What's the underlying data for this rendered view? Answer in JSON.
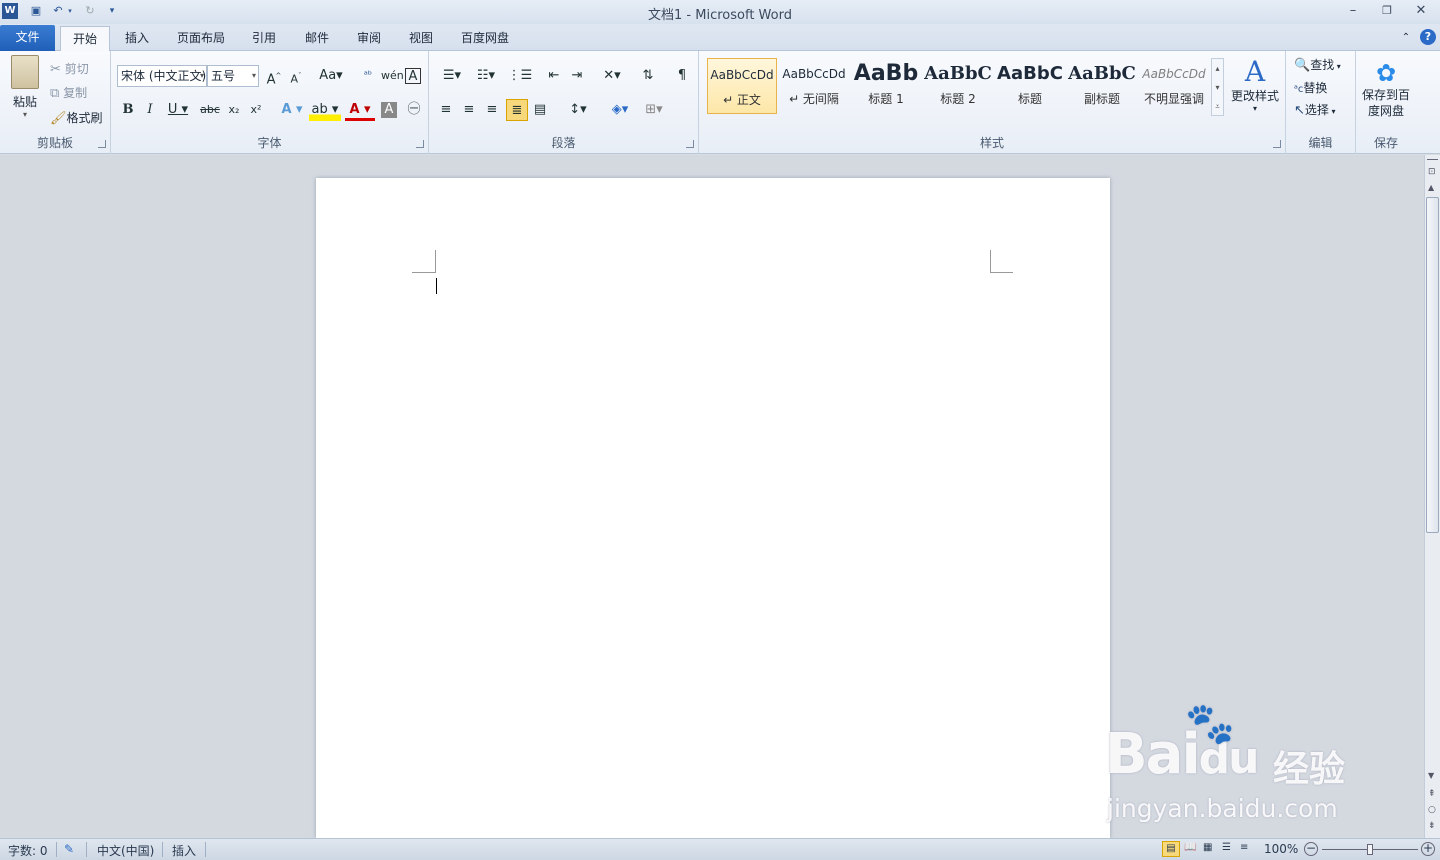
{
  "window": {
    "title": "文档1 - Microsoft Word"
  },
  "tabs": [
    {
      "label": "文件"
    },
    {
      "label": "开始"
    },
    {
      "label": "插入"
    },
    {
      "label": "页面布局"
    },
    {
      "label": "引用"
    },
    {
      "label": "邮件"
    },
    {
      "label": "审阅"
    },
    {
      "label": "视图"
    },
    {
      "label": "百度网盘"
    }
  ],
  "clipboard": {
    "group": "剪贴板",
    "paste": "粘贴",
    "cut": "剪切",
    "copy": "复制",
    "format_painter": "格式刷"
  },
  "font": {
    "group": "字体",
    "font_name": "宋体 (中文正文)",
    "font_size": "五号"
  },
  "paragraph": {
    "group": "段落"
  },
  "styles": {
    "group": "样式",
    "items": [
      {
        "sample": "AaBbCcDd",
        "name": "↵ 正文"
      },
      {
        "sample": "AaBbCcDd",
        "name": "↵ 无间隔"
      },
      {
        "sample": "AaBb",
        "name": "标题 1"
      },
      {
        "sample": "AaBbC",
        "name": "标题 2"
      },
      {
        "sample": "AaBbC",
        "name": "标题"
      },
      {
        "sample": "AaBbC",
        "name": "副标题"
      },
      {
        "sample": "AaBbCcDd",
        "name": "不明显强调"
      }
    ],
    "change_styles": "更改样式"
  },
  "editing": {
    "group": "编辑",
    "find": "查找",
    "replace": "替换",
    "select": "选择"
  },
  "save_group": {
    "group": "保存",
    "button": "保存到百度网盘"
  },
  "status": {
    "words": "字数: 0",
    "language": "中文(中国)",
    "mode": "插入",
    "zoom": "100%"
  },
  "watermark": {
    "brand": "Bai",
    "brand2": "du",
    "jingyan": "经验",
    "url": "jingyan.baidu.com"
  },
  "colors": {
    "file_tab": "#2b6ac6",
    "accent": "#2b5797",
    "style_selected": "#f7d97b"
  }
}
